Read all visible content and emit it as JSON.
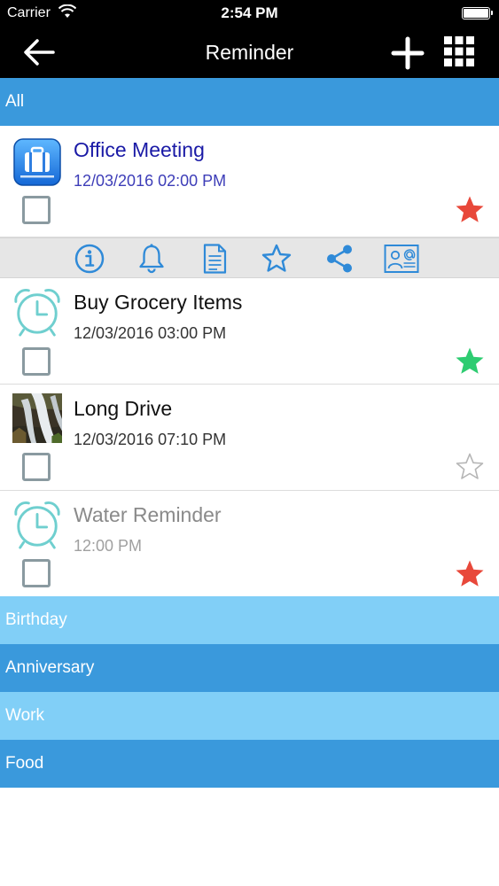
{
  "status_bar": {
    "carrier": "Carrier",
    "time": "2:54 PM",
    "icons": [
      "wifi-icon",
      "battery-icon"
    ]
  },
  "nav": {
    "title": "Reminder",
    "icons": [
      "back-arrow-icon",
      "plus-icon",
      "grid-icon"
    ]
  },
  "categories": {
    "all": "All",
    "birthday": "Birthday",
    "anniversary": "Anniversary",
    "work": "Work",
    "food": "Food"
  },
  "reminders": [
    {
      "name": "Office Meeting",
      "datetime": "12/03/2016 02:00 PM",
      "icon": "briefcase-icon",
      "star": "filled",
      "star_color": "#e8483a"
    },
    {
      "name": "Buy Grocery Items",
      "datetime": "12/03/2016 03:00 PM",
      "icon": "alarm-clock-icon",
      "star": "filled",
      "star_color": "#2ecc71"
    },
    {
      "name": "Long Drive",
      "datetime": "12/03/2016 07:10 PM",
      "icon": "waterfall-photo-icon",
      "star": "outline",
      "star_color": "#b5b5b5"
    },
    {
      "name": "Water Reminder",
      "datetime": "12:00 PM",
      "icon": "alarm-clock-icon",
      "star": "filled",
      "star_color": "#e8483a"
    }
  ],
  "actions": [
    "info-icon",
    "bell-icon",
    "note-icon",
    "star-outline-icon",
    "share-icon",
    "contact-email-icon"
  ],
  "colors": {
    "accent_dark": "#3a99dc",
    "accent_light": "#81cff7",
    "icon_blue": "#2f8ad8",
    "clock_teal": "#6fcfcf"
  }
}
